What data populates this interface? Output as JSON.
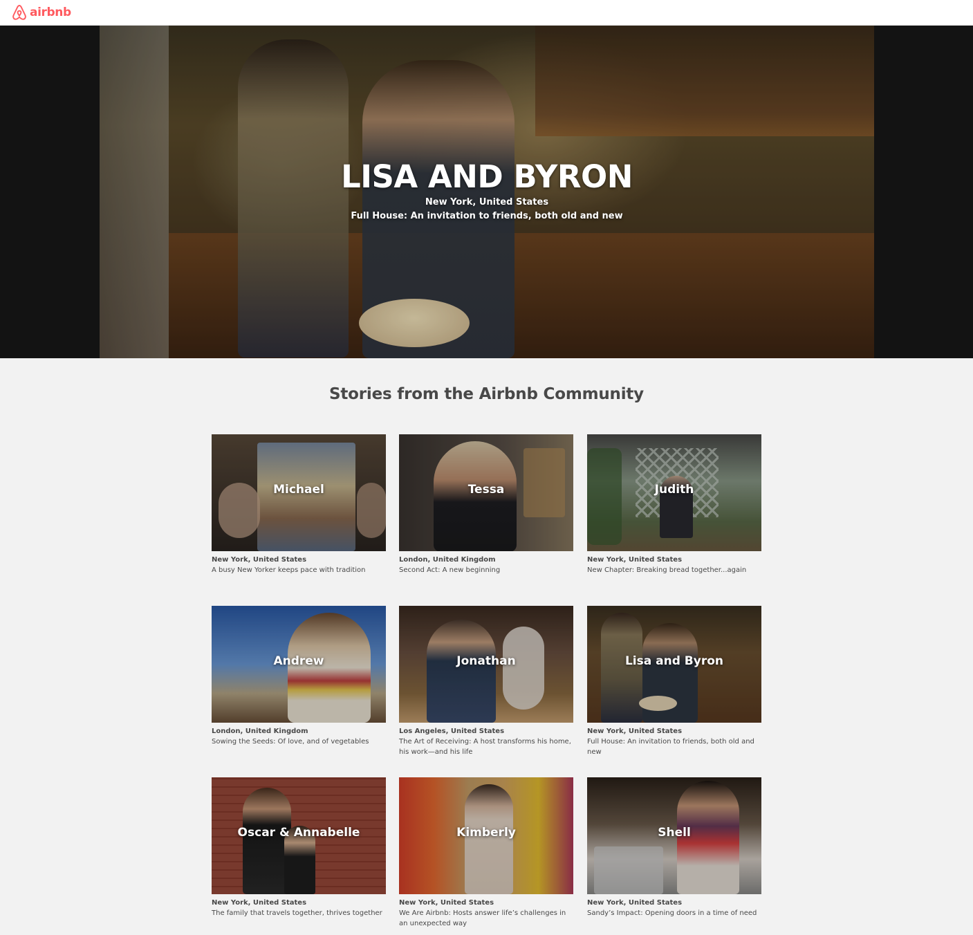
{
  "header": {
    "logo_text": "airbnb",
    "logo_icon": "airbnb-belo-icon",
    "brand_color": "#ff5a5f"
  },
  "hero": {
    "title": "LISA AND BYRON",
    "location": "New York, United States",
    "subtitle": "Full House: An invitation to friends, both old and new"
  },
  "section": {
    "title": "Stories from the Airbnb Community"
  },
  "stories": [
    {
      "name": "Michael",
      "location": "New York, United States",
      "description": "A busy New Yorker keeps pace with tradition"
    },
    {
      "name": "Tessa",
      "location": "London, United Kingdom",
      "description": "Second Act: A new beginning"
    },
    {
      "name": "Judith",
      "location": "New York, United States",
      "description": "New Chapter: Breaking bread together...again"
    },
    {
      "name": "Andrew",
      "location": "London, United Kingdom",
      "description": "Sowing the Seeds: Of love, and of vegetables"
    },
    {
      "name": "Jonathan",
      "location": "Los Angeles, United States",
      "description": "The Art of Receiving: A host transforms his home, his work—and his life"
    },
    {
      "name": "Lisa and Byron",
      "location": "New York, United States",
      "description": "Full House: An invitation to friends, both old and new"
    },
    {
      "name": "Oscar & Annabelle",
      "location": "New York, United States",
      "description": "The family that travels together, thrives together"
    },
    {
      "name": "Kimberly",
      "location": "New York, United States",
      "description": "We Are Airbnb: Hosts answer life’s challenges in an unexpected way"
    },
    {
      "name": "Shell",
      "location": "New York, United States",
      "description": "Sandy’s Impact: Opening doors in a time of need"
    }
  ]
}
